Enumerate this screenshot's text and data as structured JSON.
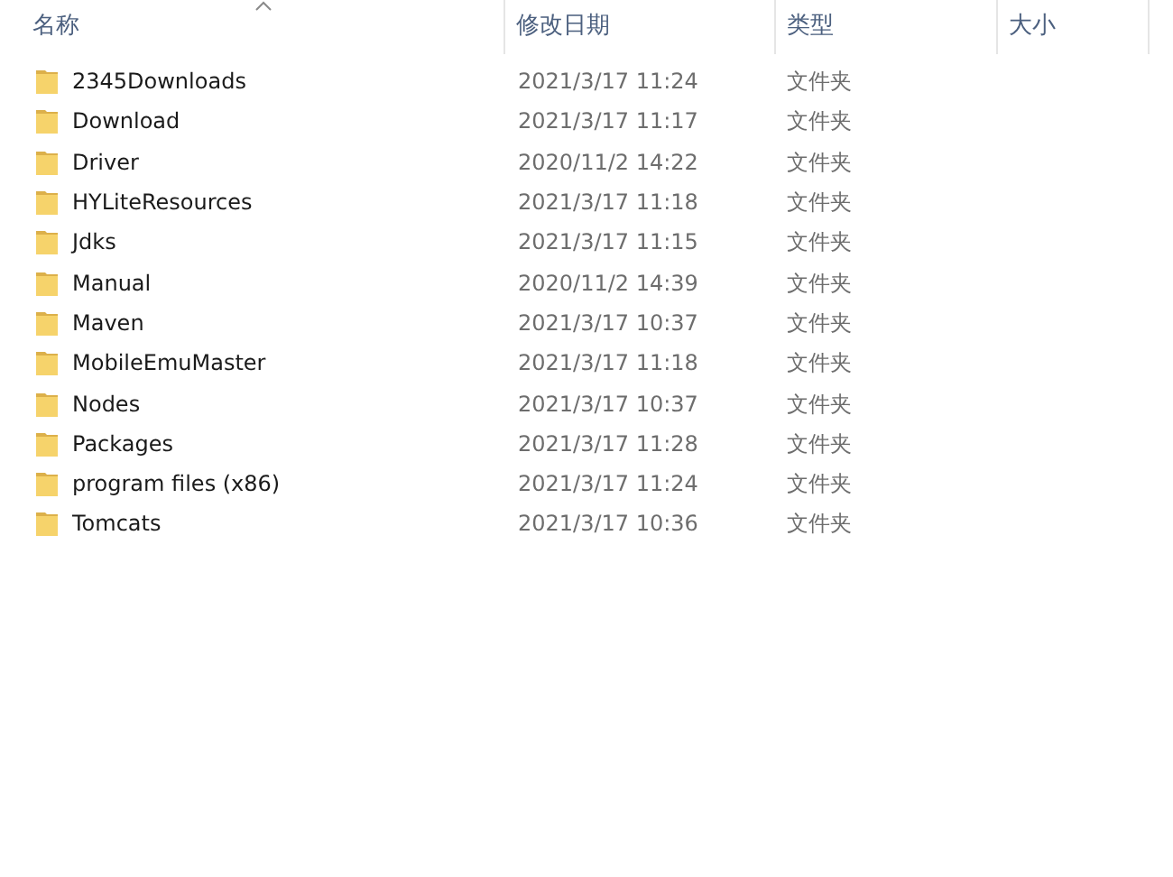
{
  "columns": [
    {
      "label": "名称",
      "sorted": true
    },
    {
      "label": "修改日期",
      "sorted": false
    },
    {
      "label": "类型",
      "sorted": false
    },
    {
      "label": "大小",
      "sorted": false
    }
  ],
  "rows": [
    {
      "name": "2345Downloads",
      "modified": "2021/3/17 11:24",
      "type": "文件夹"
    },
    {
      "name": "Download",
      "modified": "2021/3/17 11:17",
      "type": "文件夹"
    },
    {
      "name": "Driver",
      "modified": "2020/11/2 14:22",
      "type": "文件夹"
    },
    {
      "name": "HYLiteResources",
      "modified": "2021/3/17 11:18",
      "type": "文件夹"
    },
    {
      "name": "Jdks",
      "modified": "2021/3/17 11:15",
      "type": "文件夹"
    },
    {
      "name": "Manual",
      "modified": "2020/11/2 14:39",
      "type": "文件夹"
    },
    {
      "name": "Maven",
      "modified": "2021/3/17 10:37",
      "type": "文件夹"
    },
    {
      "name": "MobileEmuMaster",
      "modified": "2021/3/17 11:18",
      "type": "文件夹"
    },
    {
      "name": "Nodes",
      "modified": "2021/3/17 10:37",
      "type": "文件夹"
    },
    {
      "name": "Packages",
      "modified": "2021/3/17 11:28",
      "type": "文件夹"
    },
    {
      "name": "program files (x86)",
      "modified": "2021/3/17 11:24",
      "type": "文件夹"
    },
    {
      "name": "Tomcats",
      "modified": "2021/3/17 10:36",
      "type": "文件夹"
    }
  ]
}
